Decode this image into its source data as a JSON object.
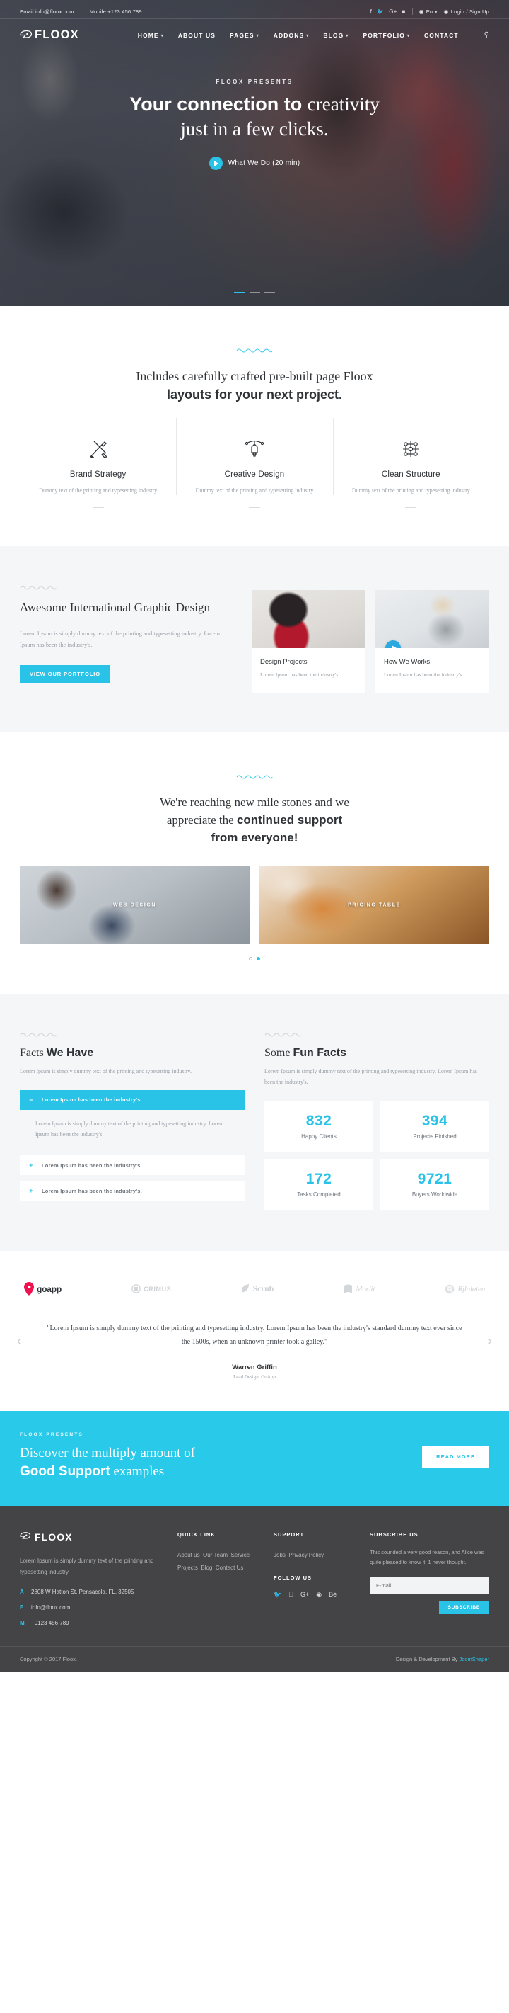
{
  "colors": {
    "accent": "#29c3e8",
    "cta_bg": "#29c9ea",
    "footer_bg": "#444446",
    "grey_bg": "#f4f6f8"
  },
  "topbar": {
    "email": "Email info@floox.com",
    "mobile": "Mobile +123 456 789",
    "lang": "En",
    "login": "Login / Sign Up",
    "socials": [
      "facebook-icon",
      "twitter-icon",
      "google-plus-icon",
      "youtube-icon"
    ]
  },
  "nav": {
    "brand": "FLOOX",
    "items": [
      {
        "label": "HOME",
        "caret": true
      },
      {
        "label": "ABOUT US",
        "caret": false
      },
      {
        "label": "PAGES",
        "caret": true
      },
      {
        "label": "ADDONS",
        "caret": true
      },
      {
        "label": "BLOG",
        "caret": true
      },
      {
        "label": "PORTFOLIO",
        "caret": true
      },
      {
        "label": "CONTACT",
        "caret": false
      }
    ],
    "search": "search-icon"
  },
  "hero": {
    "eyebrow": "FLOOX PRESENTS",
    "title_bold": "Your connection to ",
    "title_light": "creativity",
    "title_line2": "just in a few clicks.",
    "play_label": "What We Do (20 min)",
    "slides": 3,
    "active_slide": 1
  },
  "intro": {
    "line1": "Includes carefully crafted pre-built page Floox",
    "line2": "layouts for your next project.",
    "features": [
      {
        "icon": "brush-pen-icon",
        "title": "Brand Strategy",
        "desc": "Dummy text of the printing and typesetting industry"
      },
      {
        "icon": "pen-tool-icon",
        "title": "Creative Design",
        "desc": "Dummy text of the printing and typesetting industry"
      },
      {
        "icon": "nodes-icon",
        "title": "Clean Structure",
        "desc": "Dummy text of the printing and typesetting industry"
      }
    ]
  },
  "graphic_design": {
    "title_light": "Awesome ",
    "title_bold": "International Graphic",
    "title_tail": " Design",
    "desc": "Lorem Ipsum is simply dummy text of the printing and typesetting industry. Lorem Ipsum has been the industry's.",
    "button": "VIEW OUR PORTFOLIO",
    "cards": [
      {
        "title": "Design Projects",
        "desc": "Lorem Ipsum has been the industry's.",
        "has_play": false
      },
      {
        "title": "How We Works",
        "desc": "Lorem Ipsum has been the industry's.",
        "has_play": true
      }
    ]
  },
  "milestones": {
    "line1": "We're reaching new mile stones and we",
    "line2_light": "appreciate the ",
    "line2_bold": "continued support",
    "line3": "from everyone!",
    "gallery": [
      {
        "label": "WEB DESIGN"
      },
      {
        "label": "PRICING TABLE"
      }
    ],
    "dots": 2,
    "active_dot": 1
  },
  "facts": {
    "left": {
      "title_light": "Facts ",
      "title_bold": "We Have",
      "desc": "Lorem Ipsum is simply dummy text of the printing and typesetting industry.",
      "accordion": [
        {
          "sign": "−",
          "label": "Lorem Ipsum has been the industry's.",
          "open": true,
          "body": "Lorem Ipsum is simply dummy text of the printing and typesetting industry. Lorem Ipsum has been the industry's."
        },
        {
          "sign": "+",
          "label": "Lorem Ipsum has been the industry's.",
          "open": false,
          "body": ""
        },
        {
          "sign": "+",
          "label": "Lorem Ipsum has been the industry's.",
          "open": false,
          "body": ""
        }
      ]
    },
    "right": {
      "title_light": "Some ",
      "title_bold": "Fun Facts",
      "desc": "Lorem Ipsum is simply dummy text of the printing and typesetting industry. Lorem Ipsum has been the industry's.",
      "counters": [
        {
          "value": "832",
          "label": "Happy Clients"
        },
        {
          "value": "394",
          "label": "Projects Finished"
        },
        {
          "value": "172",
          "label": "Tasks Completed"
        },
        {
          "value": "9721",
          "label": "Buyers Worldwide"
        }
      ]
    }
  },
  "clients": [
    {
      "name": "goapp",
      "style": "first"
    },
    {
      "name": "CRIMUS",
      "style": "caps"
    },
    {
      "name": "Scrub",
      "style": "serif"
    },
    {
      "name": "Morlit",
      "style": "script"
    },
    {
      "name": "Rjlalaten",
      "style": "script"
    }
  ],
  "testimonial": {
    "quote": "\"Lorem Ipsum is simply dummy text of the printing and typesetting industry. Lorem Ipsum has been the industry's standard dummy text ever since the 1500s, when an unknown printer took a galley.\"",
    "name": "Warren Griffin",
    "role": "Lead Design, GoApp",
    "prev": "‹",
    "next": "›"
  },
  "cta": {
    "eyebrow": "FLOOX PRESENTS",
    "line1": "Discover the multiply amount of",
    "line2_bold": "Good Support",
    "line2_tail": " examples",
    "button": "READ MORE"
  },
  "footer": {
    "brand": "FLOOX",
    "about": "Lorem Ipsum is simply dummy text of the printing and typesetting industry",
    "contact": [
      {
        "key": "A",
        "value": "2808 W Hatton St, Pensacola, FL, 32505"
      },
      {
        "key": "E",
        "value": "info@floox.com"
      },
      {
        "key": "M",
        "value": "+0123 456 789"
      }
    ],
    "quick_link": {
      "heading": "QUICK LINK",
      "items": [
        "About us",
        "Our Team",
        "Service",
        "Projects",
        "Blog",
        "Contact Us"
      ]
    },
    "support": {
      "heading": "SUPPORT",
      "items": [
        "Jobs",
        "Privacy Policy"
      ]
    },
    "follow": {
      "heading": "FOLLOW US",
      "icons": [
        "twitter-icon",
        "facebook-icon",
        "google-plus-icon",
        "dribbble-icon",
        "behance-icon"
      ]
    },
    "subscribe": {
      "heading": "SUBSCRIBE US",
      "text": "This sounded a very good reason, and Alice was quite pleased to know it. 1 never thought.",
      "placeholder": "E-mail",
      "value": "",
      "button": "SUBSCRIBE"
    },
    "copyright": "Copyright © 2017 Floox.",
    "credit_prefix": "Design & Development By ",
    "credit_link": "JoomShaper"
  }
}
